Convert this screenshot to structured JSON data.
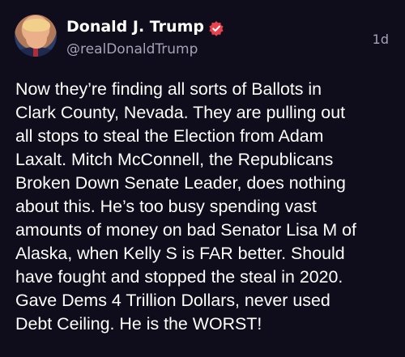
{
  "post": {
    "author": {
      "display_name": "Donald J. Trump",
      "handle": "@realDonaldTrump",
      "verified": true,
      "verified_badge_color": "#e8424f",
      "avatar_icon": "profile-photo"
    },
    "timestamp": "1d",
    "text_lines": [
      "Now they’re finding all sorts of Ballots in",
      "Clark County, Nevada. They are pulling out",
      "all stops to steal the Election from Adam",
      "Laxalt. Mitch McConnell, the Republicans",
      "Broken Down Senate Leader, does nothing",
      "about this. He’s too busy spending vast",
      "amounts of money on bad Senator Lisa M of",
      "Alaska, when Kelly S is FAR better. Should",
      "have fought and stopped the steal in 2020.",
      "Gave Dems 4 Trillion Dollars, never used",
      "Debt Ceiling. He is the WORST!"
    ]
  },
  "colors": {
    "background": "#0f0c1b",
    "text": "#ffffff",
    "secondary_text": "#a6a2b8"
  }
}
